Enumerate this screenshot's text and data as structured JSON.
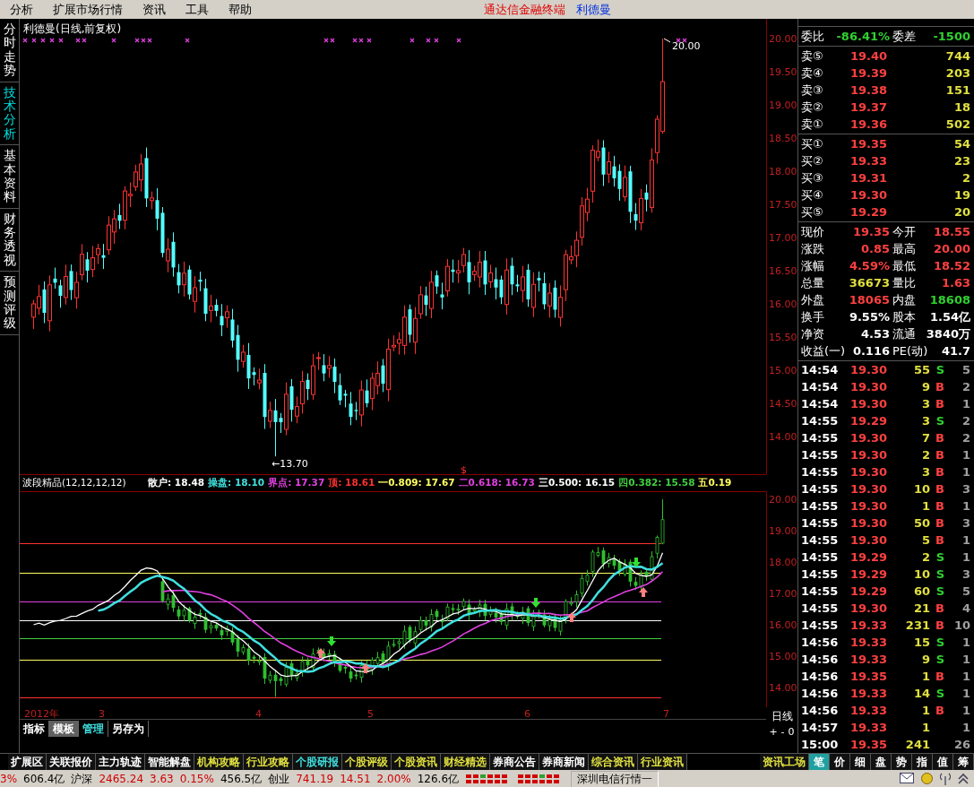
{
  "menu": {
    "items": [
      "分析",
      "扩展市场行情",
      "资讯",
      "工具",
      "帮助"
    ],
    "app_title": "通达信金融终端",
    "stock_name": "利德曼"
  },
  "side_tabs": [
    {
      "label": "分时走势",
      "selected": false
    },
    {
      "label": "技术分析",
      "selected": true
    },
    {
      "label": "基本资料",
      "selected": false
    },
    {
      "label": "财务透视",
      "selected": false
    },
    {
      "label": "预测评级",
      "selected": false
    }
  ],
  "price_chart": {
    "title": "利德曼(日线,前复权)",
    "y_ticks": [
      "20.00",
      "19.50",
      "19.00",
      "18.50",
      "18.00",
      "17.50",
      "17.00",
      "16.50",
      "16.00",
      "15.50",
      "15.00",
      "14.50",
      "14.00"
    ],
    "high_label": "20.00",
    "low_label": "←13.70",
    "signal": "$"
  },
  "indicator": {
    "name": "波段精品(12,12,12,12)",
    "values": [
      {
        "label": "散户: 18.48",
        "color": "#ffffff"
      },
      {
        "label": "操盘: 18.10",
        "color": "#40e0e0"
      },
      {
        "label": "界点: 17.37",
        "color": "#e040e0"
      },
      {
        "label": "顶: 18.61",
        "color": "#ff3030"
      },
      {
        "label": "一0.809: 17.67",
        "color": "#ffff60"
      },
      {
        "label": "二0.618: 16.73",
        "color": "#e040e0"
      },
      {
        "label": "三0.500: 16.15",
        "color": "#ffffff"
      },
      {
        "label": "四0.382: 15.58",
        "color": "#40d040"
      },
      {
        "label": "五0.19",
        "color": "#ffff60"
      }
    ],
    "y_ticks": [
      "20.00",
      "19.00",
      "18.00",
      "17.00",
      "16.00",
      "15.00",
      "14.00"
    ]
  },
  "date_axis": [
    "2012年",
    "3",
    "4",
    "5",
    "6",
    "7"
  ],
  "panel_tabs": [
    {
      "label": "指标",
      "selected": false,
      "kind": "tab"
    },
    {
      "label": "模板",
      "selected": true,
      "kind": "tab"
    },
    {
      "label": "管理",
      "selected": false,
      "kind": "link"
    },
    {
      "label": "另存为",
      "selected": false,
      "kind": "tab"
    }
  ],
  "period": "日线",
  "zoom_buttons": [
    "+",
    "-",
    "0"
  ],
  "quote": {
    "order_ratio": [
      {
        "label": "委比",
        "value": "-86.41%",
        "kind": "down"
      },
      {
        "label": "委差",
        "value": "-1500",
        "kind": "down"
      }
    ],
    "asks": [
      {
        "label": "卖⑤",
        "price": "19.40",
        "volume": "744"
      },
      {
        "label": "卖④",
        "price": "19.39",
        "volume": "203"
      },
      {
        "label": "卖③",
        "price": "19.38",
        "volume": "151"
      },
      {
        "label": "卖②",
        "price": "19.37",
        "volume": "18"
      },
      {
        "label": "卖①",
        "price": "19.36",
        "volume": "502"
      }
    ],
    "bids": [
      {
        "label": "买①",
        "price": "19.35",
        "volume": "54"
      },
      {
        "label": "买②",
        "price": "19.33",
        "volume": "23"
      },
      {
        "label": "买③",
        "price": "19.31",
        "volume": "2"
      },
      {
        "label": "买④",
        "price": "19.30",
        "volume": "19"
      },
      {
        "label": "买⑤",
        "price": "19.29",
        "volume": "20"
      }
    ],
    "stats": [
      {
        "label": "现价",
        "value": "19.35",
        "kind": "up"
      },
      {
        "label": "今开",
        "value": "18.55",
        "kind": "up"
      },
      {
        "label": "涨跌",
        "value": "0.85",
        "kind": "up"
      },
      {
        "label": "最高",
        "value": "20.00",
        "kind": "up"
      },
      {
        "label": "涨幅",
        "value": "4.59%",
        "kind": "up"
      },
      {
        "label": "最低",
        "value": "18.52",
        "kind": "up"
      },
      {
        "label": "总量",
        "value": "36673",
        "kind": "volume"
      },
      {
        "label": "量比",
        "value": "1.63",
        "kind": "up"
      },
      {
        "label": "外盘",
        "value": "18065",
        "kind": "up"
      },
      {
        "label": "内盘",
        "value": "18608",
        "kind": "down"
      },
      {
        "label": "换手",
        "value": "9.55%",
        "kind": "plain"
      },
      {
        "label": "股本",
        "value": "1.54亿",
        "kind": "plain"
      },
      {
        "label": "净资",
        "value": "4.53",
        "kind": "plain"
      },
      {
        "label": "流通",
        "value": "3840万",
        "kind": "plain"
      },
      {
        "label": "收益(一)",
        "value": "0.116",
        "kind": "plain"
      },
      {
        "label": "PE(动)",
        "value": "41.7",
        "kind": "plain"
      }
    ]
  },
  "trades": [
    {
      "time": "14:54",
      "price": "19.30",
      "volume": "55",
      "side": "S",
      "kind": "sell",
      "count": "5"
    },
    {
      "time": "14:54",
      "price": "19.30",
      "volume": "9",
      "side": "B",
      "kind": "buy",
      "count": "2"
    },
    {
      "time": "14:54",
      "price": "19.30",
      "volume": "3",
      "side": "B",
      "kind": "buy",
      "count": "1"
    },
    {
      "time": "14:55",
      "price": "19.29",
      "volume": "3",
      "side": "S",
      "kind": "sell",
      "count": "2"
    },
    {
      "time": "14:55",
      "price": "19.30",
      "volume": "7",
      "side": "B",
      "kind": "buy",
      "count": "2"
    },
    {
      "time": "14:55",
      "price": "19.30",
      "volume": "2",
      "side": "B",
      "kind": "buy",
      "count": "1"
    },
    {
      "time": "14:55",
      "price": "19.30",
      "volume": "3",
      "side": "B",
      "kind": "buy",
      "count": "1"
    },
    {
      "time": "14:55",
      "price": "19.30",
      "volume": "10",
      "side": "B",
      "kind": "buy",
      "count": "3"
    },
    {
      "time": "14:55",
      "price": "19.30",
      "volume": "1",
      "side": "B",
      "kind": "buy",
      "count": "1"
    },
    {
      "time": "14:55",
      "price": "19.30",
      "volume": "50",
      "side": "B",
      "kind": "buy",
      "count": "3"
    },
    {
      "time": "14:55",
      "price": "19.30",
      "volume": "5",
      "side": "B",
      "kind": "buy",
      "count": "1"
    },
    {
      "time": "14:55",
      "price": "19.29",
      "volume": "2",
      "side": "S",
      "kind": "sell",
      "count": "1"
    },
    {
      "time": "14:55",
      "price": "19.29",
      "volume": "10",
      "side": "S",
      "kind": "sell",
      "count": "3"
    },
    {
      "time": "14:55",
      "price": "19.29",
      "volume": "60",
      "side": "S",
      "kind": "sell",
      "count": "5"
    },
    {
      "time": "14:55",
      "price": "19.30",
      "volume": "21",
      "side": "B",
      "kind": "buy",
      "count": "4"
    },
    {
      "time": "14:55",
      "price": "19.33",
      "volume": "231",
      "side": "B",
      "kind": "buy",
      "count": "10"
    },
    {
      "time": "14:56",
      "price": "19.33",
      "volume": "15",
      "side": "S",
      "kind": "sell",
      "count": "1"
    },
    {
      "time": "14:56",
      "price": "19.33",
      "volume": "9",
      "side": "S",
      "kind": "sell",
      "count": "1"
    },
    {
      "time": "14:56",
      "price": "19.35",
      "volume": "1",
      "side": "B",
      "kind": "buy",
      "count": "1"
    },
    {
      "time": "14:56",
      "price": "19.33",
      "volume": "14",
      "side": "S",
      "kind": "sell",
      "count": "1"
    },
    {
      "time": "14:56",
      "price": "19.33",
      "volume": "1",
      "side": "B",
      "kind": "buy",
      "count": "1"
    },
    {
      "time": "14:57",
      "price": "19.33",
      "volume": "1",
      "count": "1"
    },
    {
      "time": "15:00",
      "price": "19.35",
      "volume": "241",
      "count": "26"
    }
  ],
  "info_tabs": {
    "left": [
      {
        "label": "扩展区",
        "color": "#ffffff"
      },
      {
        "label": "关联报价",
        "color": "#ffffff"
      },
      {
        "label": "主力轨迹",
        "color": "#ffffff"
      },
      {
        "label": "智能解盘",
        "color": "#ffffff"
      },
      {
        "label": "机构攻略",
        "color": "#e0e040"
      },
      {
        "label": "行业攻略",
        "color": "#e0e040"
      },
      {
        "label": "个股研报",
        "color": "#40e0e0"
      },
      {
        "label": "个股评级",
        "color": "#e0e040"
      },
      {
        "label": "个股资讯",
        "color": "#e0e040"
      },
      {
        "label": "财经精选",
        "color": "#e0e040"
      },
      {
        "label": "券商公告",
        "color": "#ffffff"
      },
      {
        "label": "券商新闻",
        "color": "#ffffff"
      },
      {
        "label": "综合资讯",
        "color": "#e0e040"
      },
      {
        "label": "行业资讯",
        "color": "#e0e040"
      }
    ],
    "right_link": "资讯工场",
    "right": [
      {
        "label": "笔",
        "selected": true
      },
      {
        "label": "价",
        "selected": false
      },
      {
        "label": "细",
        "selected": false
      },
      {
        "label": "盘",
        "selected": false
      },
      {
        "label": "势",
        "selected": false
      },
      {
        "label": "指",
        "selected": false
      },
      {
        "label": "值",
        "selected": false
      },
      {
        "label": "筹",
        "selected": false
      }
    ]
  },
  "status": {
    "items": [
      {
        "text": "3%",
        "kind": "up"
      },
      {
        "text": "606.4亿",
        "kind": "plain"
      },
      {
        "text": "沪深",
        "kind": "plain"
      },
      {
        "text": "2465.24",
        "kind": "up"
      },
      {
        "text": "3.63",
        "kind": "up"
      },
      {
        "text": "0.15%",
        "kind": "up"
      },
      {
        "text": "456.5亿",
        "kind": "plain"
      },
      {
        "text": "创业",
        "kind": "plain"
      },
      {
        "text": "741.19",
        "kind": "up"
      },
      {
        "text": "14.51",
        "kind": "up"
      },
      {
        "text": "2.00%",
        "kind": "up"
      },
      {
        "text": "126.6亿",
        "kind": "plain"
      }
    ],
    "feed": "深圳电信行情一"
  }
}
